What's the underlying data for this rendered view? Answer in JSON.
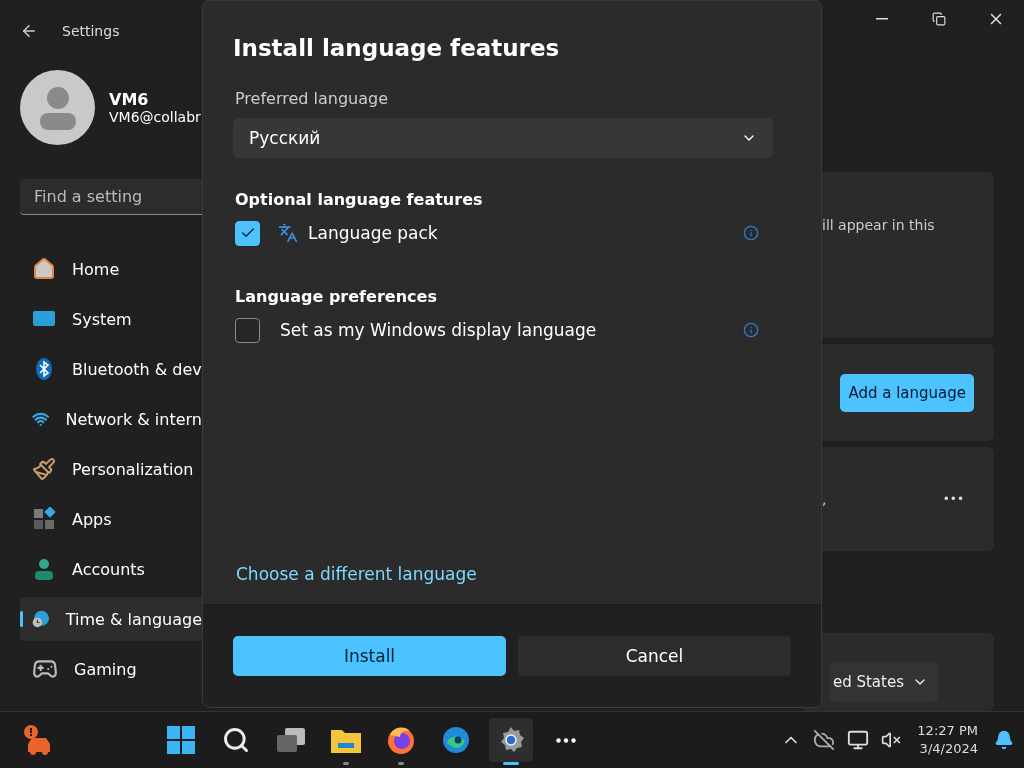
{
  "window": {
    "title": "Settings"
  },
  "account": {
    "name": "VM6",
    "email": "VM6@collabr"
  },
  "search": {
    "placeholder": "Find a setting"
  },
  "nav": [
    {
      "label": "Home",
      "selected": false
    },
    {
      "label": "System",
      "selected": false
    },
    {
      "label": "Bluetooth & dev",
      "selected": false
    },
    {
      "label": "Network & intern",
      "selected": false
    },
    {
      "label": "Personalization",
      "selected": false
    },
    {
      "label": "Apps",
      "selected": false
    },
    {
      "label": "Accounts",
      "selected": false
    },
    {
      "label": "Time & language",
      "selected": true
    },
    {
      "label": "Gaming",
      "selected": false
    }
  ],
  "content": {
    "note": "ill appear in this",
    "add_button": "Add a language",
    "language_note": ",",
    "more": "•••",
    "region_value": "ed States"
  },
  "dialog": {
    "title": "Install language features",
    "preferred_label": "Preferred language",
    "preferred_value": "Русский",
    "sections": [
      {
        "heading": "Optional language features",
        "options": [
          {
            "label": "Language pack",
            "checked": true,
            "kind": "feature"
          }
        ]
      },
      {
        "heading": "Language preferences",
        "options": [
          {
            "label": "Set as my Windows display language",
            "checked": false,
            "kind": "setting"
          }
        ]
      }
    ],
    "link": "Choose a different language",
    "primary": "Install",
    "secondary": "Cancel"
  },
  "taskbar": {
    "apps": [
      {
        "kind": "start",
        "running": false,
        "selected": false
      },
      {
        "kind": "search",
        "running": false,
        "selected": false
      },
      {
        "kind": "taskview",
        "running": false,
        "selected": false
      },
      {
        "kind": "explorer",
        "running": true,
        "selected": false
      },
      {
        "kind": "firefox",
        "running": true,
        "selected": false
      },
      {
        "kind": "edge",
        "running": false,
        "selected": false
      },
      {
        "kind": "settings",
        "running": true,
        "selected": true
      },
      {
        "kind": "more",
        "running": false,
        "selected": false
      }
    ],
    "time": "12:27 PM",
    "date": "3/4/2024"
  }
}
